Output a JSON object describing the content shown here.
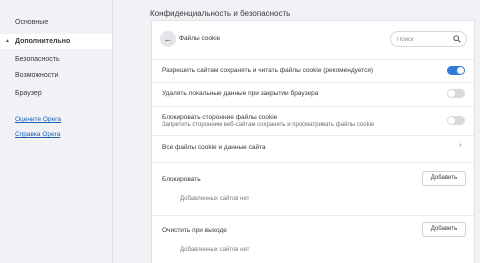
{
  "sidebar": {
    "items": [
      {
        "label": "Основные"
      },
      {
        "label": "Дополнительно"
      },
      {
        "label": "Безопасность"
      },
      {
        "label": "Возможности"
      },
      {
        "label": "Браузер"
      }
    ],
    "links": [
      {
        "label": "Оцените Opera"
      },
      {
        "label": "Справка Opera"
      }
    ]
  },
  "page_title": "Конфиденциальность и безопасность",
  "subpage": {
    "title": "Файлы cookie",
    "search_placeholder": "Поиск"
  },
  "settings": {
    "allow_cookies": {
      "label": "Разрешить сайтам сохранять и читать файлы cookie (рекомендуется)",
      "enabled": true
    },
    "clear_on_exit": {
      "label": "Удалять локальные данные при закрытии браузера",
      "enabled": false
    },
    "block_third_party": {
      "label": "Блокировать сторонние файлы cookie",
      "sub": "Запретить сторонним веб-сайтам сохранять и просматривать файлы cookie",
      "enabled": false
    },
    "all_cookies": {
      "label": "Все файлы cookie и данные сайта"
    }
  },
  "sections": {
    "block": {
      "title": "Блокировать",
      "button": "Добавить",
      "empty": "Добавленных сайтов нет"
    },
    "clear_on_exit": {
      "title": "Очистить при выходе",
      "button": "Добавить",
      "empty": "Добавленных сайтов нет"
    }
  },
  "colors": {
    "accent": "#2f7bd6",
    "link": "#1a5fb4"
  }
}
